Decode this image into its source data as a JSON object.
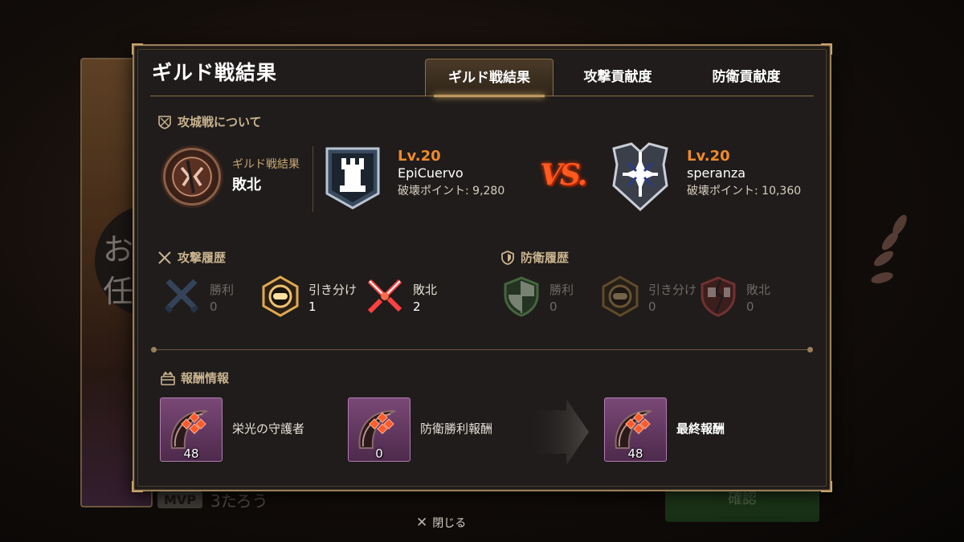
{
  "background": {
    "char_line1": "お",
    "char_line2": "任",
    "mvp_badge": "MVP",
    "mvp_name": "3たろう",
    "confirm_label": "確認"
  },
  "dialog": {
    "title": "ギルド戦結果",
    "tabs": [
      {
        "label": "ギルド戦結果",
        "active": true
      },
      {
        "label": "攻撃貢献度",
        "active": false
      },
      {
        "label": "防衛貢献度",
        "active": false
      }
    ]
  },
  "siege": {
    "heading": "攻城戦について",
    "result_label": "ギルド戦結果",
    "result_value": "敗北",
    "ally": {
      "level": "Lv.20",
      "name": "EpiCuervo",
      "points": "破壊ポイント: 9,280"
    },
    "vs_text": "VS.",
    "enemy": {
      "level": "Lv.20",
      "name": "speranza",
      "points": "破壊ポイント: 10,360"
    }
  },
  "attack_history": {
    "heading": "攻撃履歴",
    "stats": [
      {
        "label": "勝利",
        "value": "0"
      },
      {
        "label": "引き分け",
        "value": "1"
      },
      {
        "label": "敗北",
        "value": "2"
      }
    ]
  },
  "defense_history": {
    "heading": "防衛履歴",
    "stats": [
      {
        "label": "勝利",
        "value": "0"
      },
      {
        "label": "引き分け",
        "value": "0"
      },
      {
        "label": "敗北",
        "value": "0"
      }
    ]
  },
  "rewards": {
    "heading": "報酬情報",
    "items": [
      {
        "label": "栄光の守護者",
        "count": "48"
      },
      {
        "label": "防衛勝利報酬",
        "count": "0"
      },
      {
        "label": "最終報酬",
        "count": "48"
      }
    ]
  },
  "close_label": "閉じる",
  "colors": {
    "accent": "#e0b46a",
    "level": "#f08a2a",
    "border": "#9a7f5a",
    "reward_bg": "#7a4876"
  }
}
